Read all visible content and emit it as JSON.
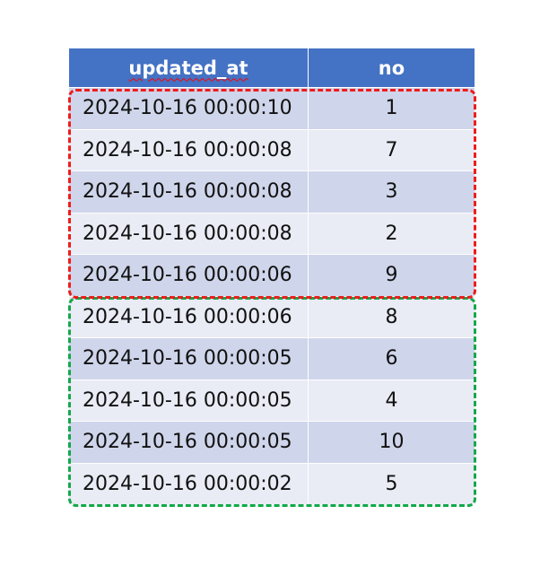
{
  "table": {
    "columns": [
      "updated_at",
      "no"
    ],
    "header_color": "#4472c4",
    "band_colors": [
      "#cfd5ea",
      "#e9ebf5"
    ],
    "rows": [
      {
        "updated_at": "2024-10-16 00:00:10",
        "no": "1"
      },
      {
        "updated_at": "2024-10-16 00:00:08",
        "no": "7"
      },
      {
        "updated_at": "2024-10-16 00:00:08",
        "no": "3"
      },
      {
        "updated_at": "2024-10-16 00:00:08",
        "no": "2"
      },
      {
        "updated_at": "2024-10-16 00:00:06",
        "no": "9"
      },
      {
        "updated_at": "2024-10-16 00:00:06",
        "no": "8"
      },
      {
        "updated_at": "2024-10-16 00:00:05",
        "no": "6"
      },
      {
        "updated_at": "2024-10-16 00:00:05",
        "no": "4"
      },
      {
        "updated_at": "2024-10-16 00:00:05",
        "no": "10"
      },
      {
        "updated_at": "2024-10-16 00:00:02",
        "no": "5"
      }
    ]
  },
  "highlights": [
    {
      "name": "group-1",
      "color": "#ee1c1c",
      "style": "dashed",
      "rows": [
        1,
        5
      ]
    },
    {
      "name": "group-2",
      "color": "#12a84a",
      "style": "dashed",
      "rows": [
        6,
        10
      ]
    }
  ]
}
